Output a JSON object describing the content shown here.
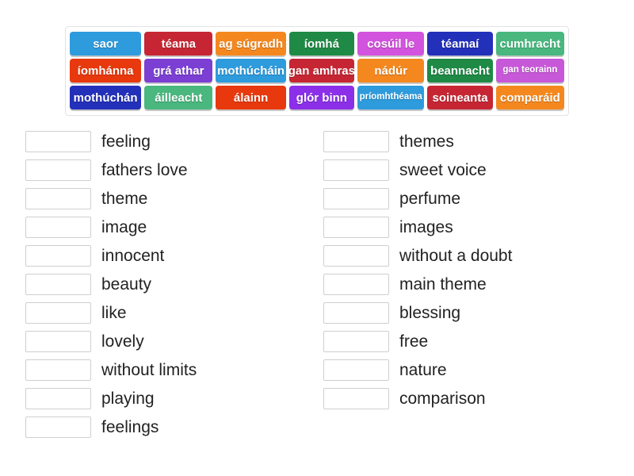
{
  "activity": {
    "type": "match-up",
    "language_pair": "Irish to English"
  },
  "tile_bank": {
    "rows": [
      [
        {
          "label": "saor",
          "color": "#2e9bdd",
          "small": false
        },
        {
          "label": "téama",
          "color": "#c62633",
          "small": false
        },
        {
          "label": "ag súgradh",
          "color": "#f4881f",
          "small": false
        },
        {
          "label": "íomhá",
          "color": "#1f8a45",
          "small": false
        },
        {
          "label": "cosúil le",
          "color": "#d253dd",
          "small": false
        },
        {
          "label": "téamaí",
          "color": "#2330ba",
          "small": false
        },
        {
          "label": "cumhracht",
          "color": "#49b77e",
          "small": false
        }
      ],
      [
        {
          "label": "íomhánna",
          "color": "#e8380d",
          "small": false
        },
        {
          "label": "grá athar",
          "color": "#7b3fd4",
          "small": false
        },
        {
          "label": "mothúcháin",
          "color": "#2e9bdd",
          "small": false
        },
        {
          "label": "gan amhras",
          "color": "#c62633",
          "small": false
        },
        {
          "label": "nádúr",
          "color": "#f4881f",
          "small": false
        },
        {
          "label": "beannacht",
          "color": "#1f8a45",
          "small": false
        },
        {
          "label": "gan teorainn",
          "color": "#c758d8",
          "small": true
        }
      ],
      [
        {
          "label": "mothúchán",
          "color": "#2330ba",
          "small": false
        },
        {
          "label": "áilleacht",
          "color": "#49b77e",
          "small": false
        },
        {
          "label": "álainn",
          "color": "#e8380d",
          "small": false
        },
        {
          "label": "glór binn",
          "color": "#8b2fe8",
          "small": false
        },
        {
          "label": "príomhthéama",
          "color": "#2e9bdd",
          "small": true
        },
        {
          "label": "soineanta",
          "color": "#c62633",
          "small": false
        },
        {
          "label": "comparáid",
          "color": "#f4881f",
          "small": false
        }
      ]
    ]
  },
  "answers": {
    "left_column": [
      "feeling",
      "fathers love",
      "theme",
      "image",
      "innocent",
      "beauty",
      "like",
      "lovely",
      "without limits",
      "playing",
      "feelings"
    ],
    "right_column": [
      "themes",
      "sweet voice",
      "perfume",
      "images",
      "without a doubt",
      "main theme",
      "blessing",
      "free",
      "nature",
      "comparison"
    ]
  }
}
